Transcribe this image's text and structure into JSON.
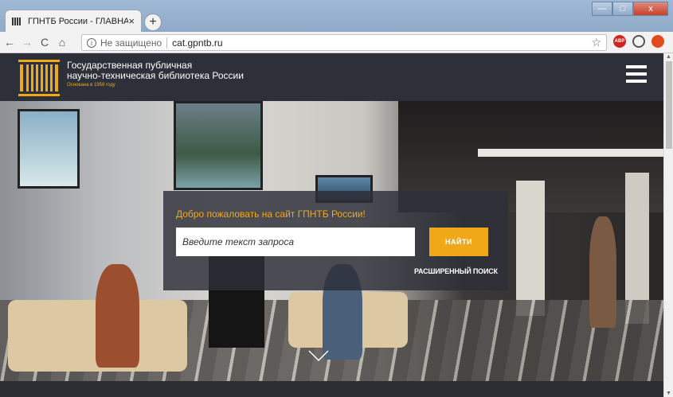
{
  "browser": {
    "tab_title": "ГПНТБ России - ГЛАВНАЯ",
    "tab_close": "×",
    "new_tab": "+",
    "back": "←",
    "forward": "→",
    "reload": "C",
    "home": "⌂",
    "security_text": "Не защищено",
    "url": "cat.gpntb.ru",
    "star": "☆",
    "window_minimize": "—",
    "window_maximize": "□",
    "window_close": "x"
  },
  "site": {
    "name_line1": "Государственная публичная",
    "name_line2": "научно-техническая библиотека России",
    "founded": "Основана в 1958 году",
    "accent_color": "#f0a818"
  },
  "search": {
    "welcome": "Добро пожаловать на сайт ГПНТБ России!",
    "placeholder": "Введите текст запроса",
    "button": "НАЙТИ",
    "advanced": "РАСШИРЕННЫЙ ПОИСК"
  }
}
